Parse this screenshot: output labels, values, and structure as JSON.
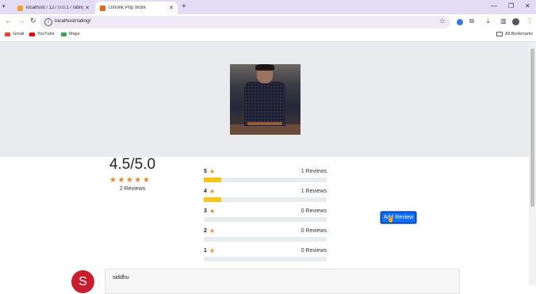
{
  "browser": {
    "tabs": [
      {
        "title": "localhost / 127.0.0.1 / ratings /",
        "close": "✕"
      },
      {
        "title": "Umonk Php Work",
        "close": "✕"
      }
    ],
    "new_tab": "+",
    "url": "localhost/rating/",
    "bookmarks": [
      {
        "label": "Gmail"
      },
      {
        "label": "YouTube"
      },
      {
        "label": "Maps"
      }
    ],
    "all_bookmarks": "All Bookmarks",
    "colors": {
      "tabstrip": "#e3dcf4",
      "omnibox": "#efeaf6"
    }
  },
  "rating_summary": {
    "average": "4.5/5.0",
    "stars": "★★★★★",
    "review_count": "2 Reviews",
    "star_color": "#e8892c"
  },
  "breakdown": [
    {
      "star": "5",
      "count": "1 Reviews",
      "fraction": 0.14
    },
    {
      "star": "4",
      "count": "1 Reviews",
      "fraction": 0.14
    },
    {
      "star": "3",
      "count": "0 Reviews",
      "fraction": 0
    },
    {
      "star": "2",
      "count": "0 Reviews",
      "fraction": 0
    },
    {
      "star": "1",
      "count": "0 Reviews",
      "fraction": 0
    }
  ],
  "star_glyph": "★",
  "add_review_label": "Add Review",
  "reviews": [
    {
      "avatar_letter": "S",
      "name": "siddhu",
      "avatar_color": "#c81e2e"
    }
  ]
}
